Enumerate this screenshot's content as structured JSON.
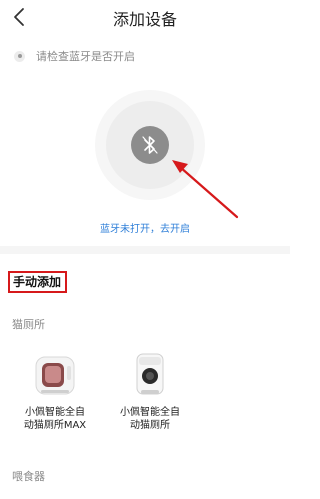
{
  "header": {
    "title": "添加设备",
    "back_icon": "chevron-left-icon"
  },
  "hint": {
    "text": "请检查蓝牙是否开启"
  },
  "bluetooth": {
    "icon": "bluetooth-disabled-icon",
    "link_text": "蓝牙未打开，去开启",
    "link_color": "#2f7fd8"
  },
  "annotation": {
    "arrow_color": "#d6191b"
  },
  "manual": {
    "title": "手动添加"
  },
  "categories": [
    {
      "name": "猫厕所",
      "devices": [
        {
          "name_line1": "小佩智能全自",
          "name_line2": "动猫厕所MAX",
          "icon": "litter-box-max-icon"
        },
        {
          "name_line1": "小佩智能全自",
          "name_line2": "动猫厕所",
          "icon": "litter-box-icon"
        }
      ]
    },
    {
      "name": "喂食器",
      "devices": []
    }
  ]
}
